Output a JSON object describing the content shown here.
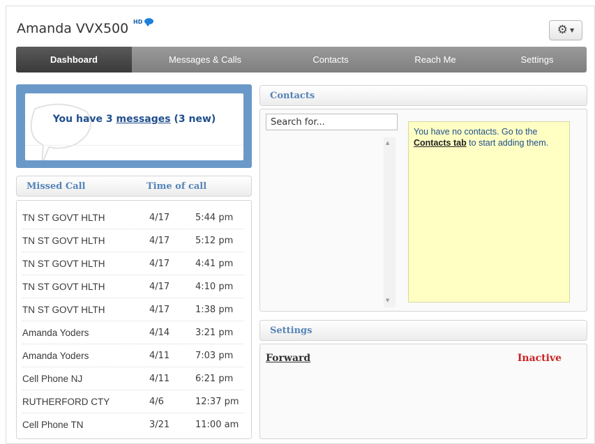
{
  "header": {
    "title": "Amanda VVX500",
    "hd_badge": "HD",
    "settings_gear_icon": "gear-icon",
    "settings_caret_icon": "caret-down-icon"
  },
  "nav": {
    "tabs": [
      {
        "label": "Dashboard",
        "active": true
      },
      {
        "label": "Messages & Calls",
        "active": false
      },
      {
        "label": "Contacts",
        "active": false
      },
      {
        "label": "Reach Me",
        "active": false
      },
      {
        "label": "Settings",
        "active": false
      }
    ]
  },
  "messages": {
    "prefix": "You have 3 ",
    "link": "messages",
    "suffix": " (3 new)"
  },
  "calls": {
    "header_name": "Missed Call",
    "header_time": "Time of call",
    "rows": [
      {
        "name": "TN ST GOVT HLTH",
        "date": "4/17",
        "time": "5:44 pm"
      },
      {
        "name": "TN ST GOVT HLTH",
        "date": "4/17",
        "time": "5:12 pm"
      },
      {
        "name": "TN ST GOVT HLTH",
        "date": "4/17",
        "time": "4:41 pm"
      },
      {
        "name": "TN ST GOVT HLTH",
        "date": "4/17",
        "time": "4:10 pm"
      },
      {
        "name": "TN ST GOVT HLTH",
        "date": "4/17",
        "time": "1:38 pm"
      },
      {
        "name": "Amanda Yoders",
        "date": "4/14",
        "time": "3:21 pm"
      },
      {
        "name": "Amanda Yoders",
        "date": "4/11",
        "time": "7:03 pm"
      },
      {
        "name": "Cell Phone NJ",
        "date": "4/11",
        "time": "6:21 pm"
      },
      {
        "name": "RUTHERFORD CTY",
        "date": "4/6",
        "time": "12:37 pm"
      },
      {
        "name": "Cell Phone TN",
        "date": "3/21",
        "time": "11:00 am"
      }
    ]
  },
  "contacts": {
    "header": "Contacts",
    "search_value": "Search for...",
    "note_prefix": "You have no contacts. Go to the ",
    "note_link": "Contacts tab",
    "note_suffix": " to start adding them."
  },
  "settings": {
    "header": "Settings",
    "forward_label": "Forward",
    "forward_status": "Inactive",
    "status_color": "#cc2222"
  },
  "colors": {
    "accent": "#5684b8",
    "nav_active": "#3a3a3a",
    "message_box": "#6a99c9",
    "note_background": "#ffffc4"
  }
}
